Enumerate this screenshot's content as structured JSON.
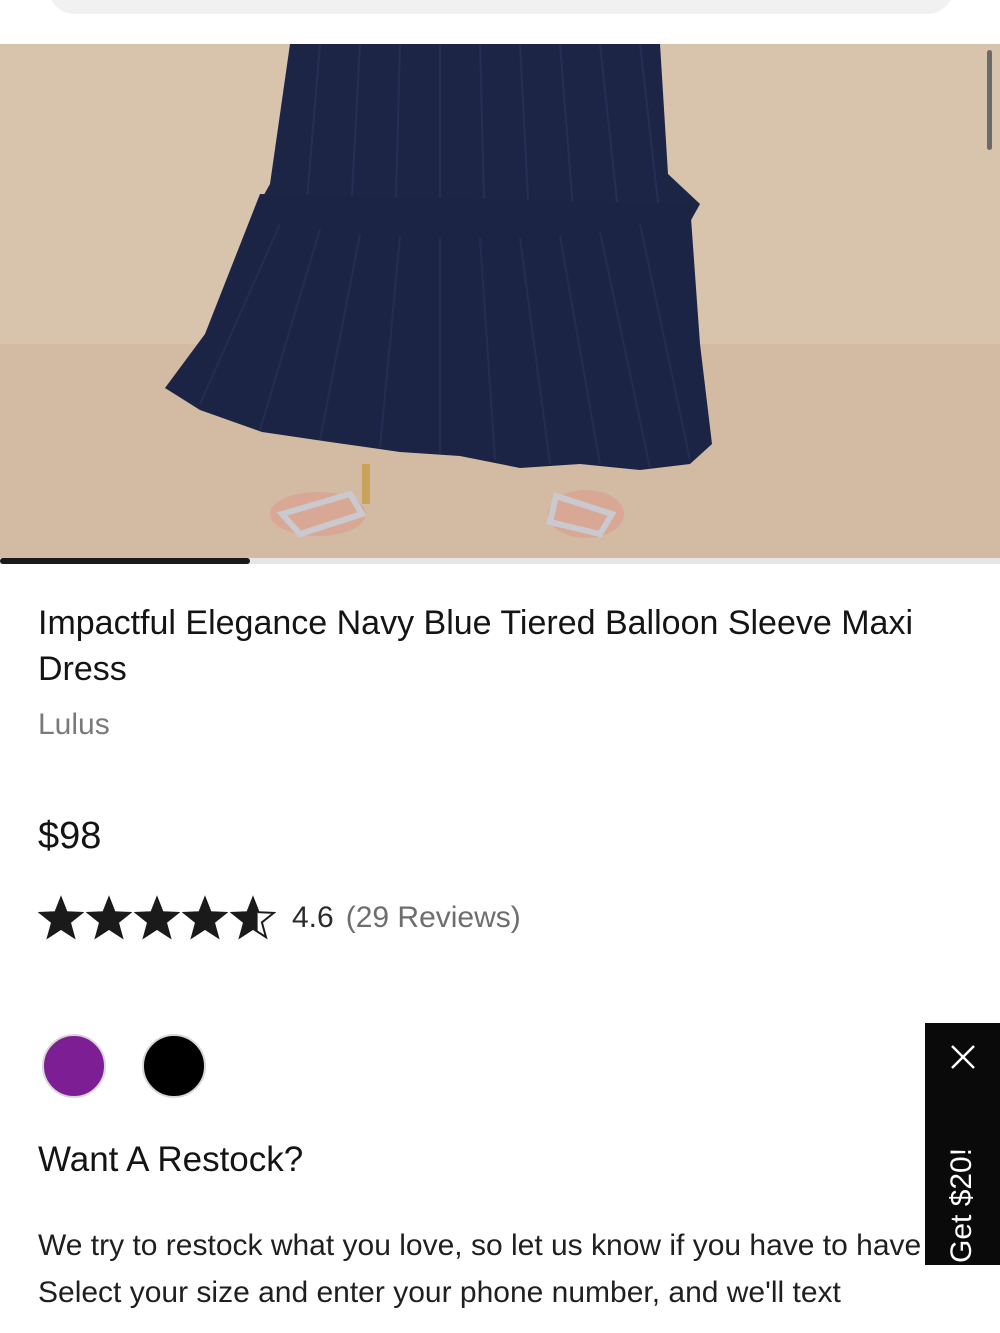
{
  "product": {
    "title": "Impactful Elegance Navy Blue Tiered Balloon Sleeve Maxi Dress",
    "brand": "Lulus",
    "price": "$98",
    "rating_value": "4.6",
    "reviews_label": "(29 Reviews)",
    "rating_stars": 4.6
  },
  "gallery": {
    "image_icon": "dress-photo",
    "progress_fraction": 0.25
  },
  "swatches": [
    {
      "color": "#7e1e94",
      "name": "purple"
    },
    {
      "color": "#000000",
      "name": "black"
    }
  ],
  "restock": {
    "heading": "Want A Restock?",
    "body": "We try to restock what you love, so let us know if you have to have it!",
    "body_cut": "Select your size and enter your phone number, and we'll text"
  },
  "promo": {
    "label": "Get $20!",
    "close_icon": "close-icon"
  },
  "colors": {
    "dress_navy": "#1c2546",
    "background_beige": "#d6c0a8",
    "promo_bg": "#0a0a0a"
  }
}
